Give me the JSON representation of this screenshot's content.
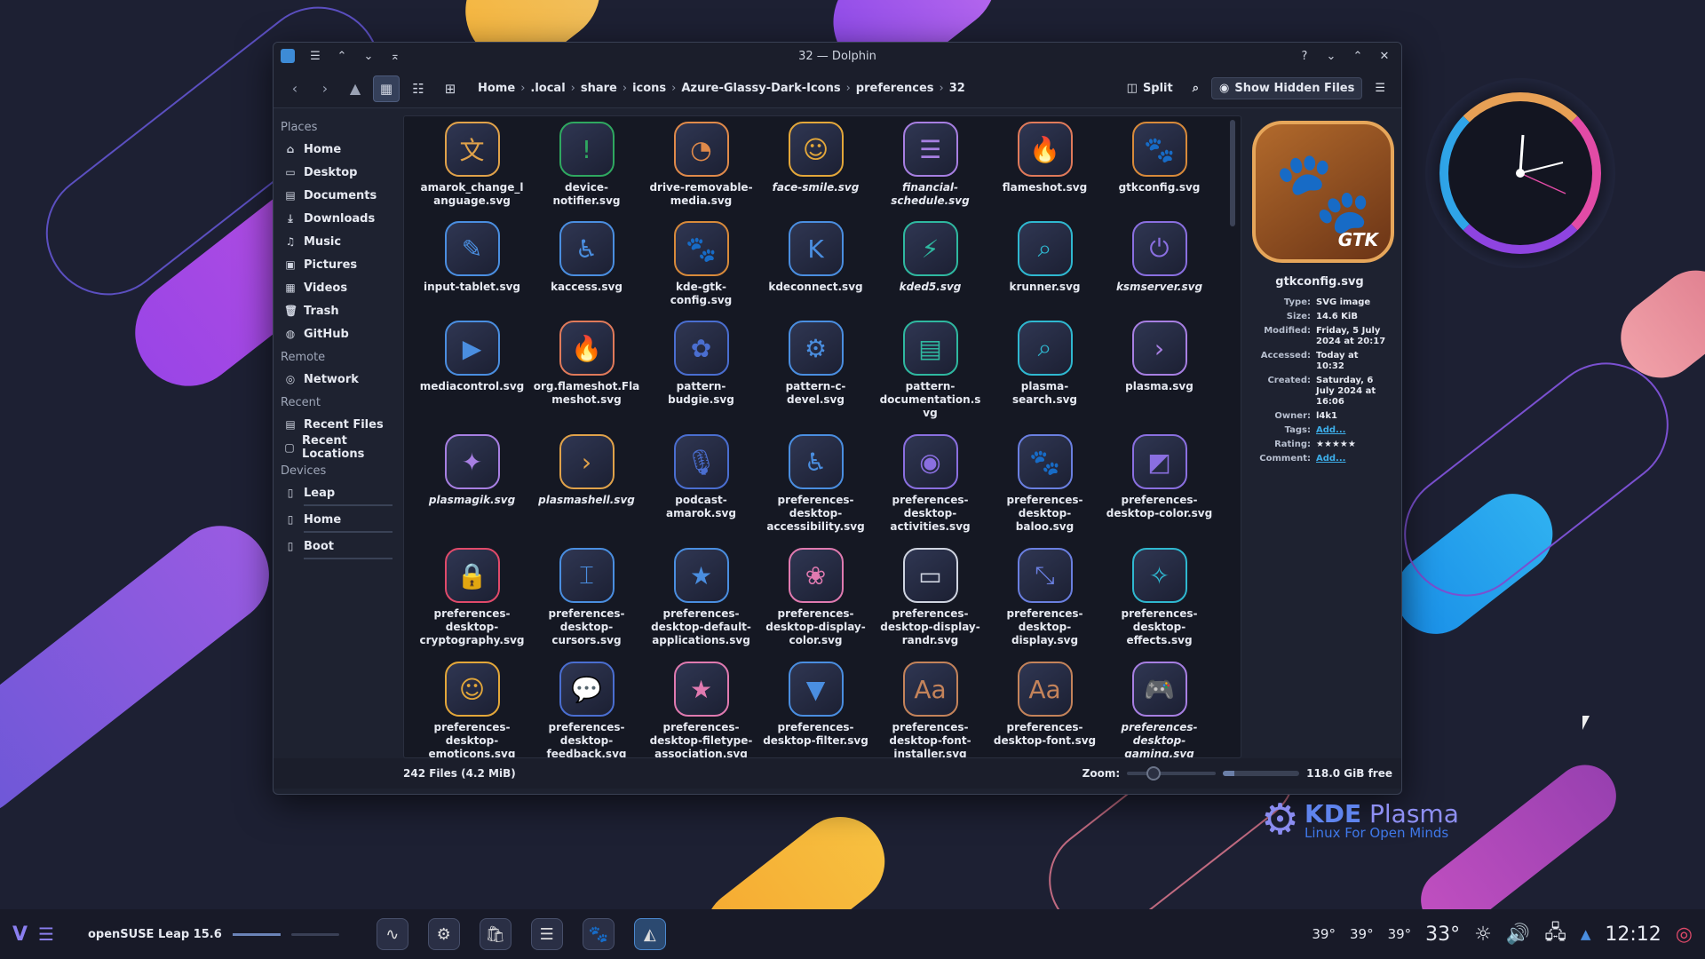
{
  "window": {
    "title": "32 — Dolphin",
    "titlebar_icons": [
      "menu-icon",
      "keep-above-icon",
      "keep-below-icon",
      "shade-icon"
    ],
    "titlebar_right": [
      "help-icon",
      "minimize-icon",
      "maximize-icon",
      "close-icon"
    ]
  },
  "toolbar": {
    "breadcrumbs": [
      "Home",
      ".local",
      "share",
      "icons",
      "Azure-Glassy-Dark-Icons",
      "preferences",
      "32"
    ],
    "split_label": "Split",
    "hidden_files_label": "Show Hidden Files"
  },
  "sidebar": {
    "places_title": "Places",
    "places": [
      {
        "label": "Home",
        "icon": "home-icon"
      },
      {
        "label": "Desktop",
        "icon": "desktop-icon"
      },
      {
        "label": "Documents",
        "icon": "documents-icon"
      },
      {
        "label": "Downloads",
        "icon": "downloads-icon"
      },
      {
        "label": "Music",
        "icon": "music-icon"
      },
      {
        "label": "Pictures",
        "icon": "pictures-icon"
      },
      {
        "label": "Videos",
        "icon": "videos-icon"
      },
      {
        "label": "Trash",
        "icon": "trash-icon"
      },
      {
        "label": "GitHub",
        "icon": "github-icon"
      }
    ],
    "remote_title": "Remote",
    "remote": [
      {
        "label": "Network",
        "icon": "network-icon"
      }
    ],
    "recent_title": "Recent",
    "recent": [
      {
        "label": "Recent Files",
        "icon": "recent-files-icon"
      },
      {
        "label": "Recent Locations",
        "icon": "recent-locations-icon"
      }
    ],
    "devices_title": "Devices",
    "devices": [
      {
        "label": "Leap",
        "icon": "drive-icon"
      },
      {
        "label": "Home",
        "icon": "drive-icon"
      },
      {
        "label": "Boot",
        "icon": "drive-icon"
      }
    ]
  },
  "files": [
    {
      "name": "amarok_change_language.svg",
      "link": false,
      "color": "#e0a24a",
      "glyph": "文"
    },
    {
      "name": "device-notifier.svg",
      "link": false,
      "color": "#2fa860",
      "glyph": "!"
    },
    {
      "name": "drive-removable-media.svg",
      "link": false,
      "color": "#e08a4a",
      "glyph": "◔"
    },
    {
      "name": "face-smile.svg",
      "link": true,
      "color": "#e3a73a",
      "glyph": "☺"
    },
    {
      "name": "financial-schedule.svg",
      "link": true,
      "color": "#a77fe2",
      "glyph": "☰"
    },
    {
      "name": "flameshot.svg",
      "link": false,
      "color": "#e07a5a",
      "glyph": "🔥"
    },
    {
      "name": "gtkconfig.svg",
      "link": false,
      "color": "#d88a3a",
      "glyph": "🐾"
    },
    {
      "name": "input-tablet.svg",
      "link": false,
      "color": "#4a8ee0",
      "glyph": "✎"
    },
    {
      "name": "kaccess.svg",
      "link": false,
      "color": "#4a8ee0",
      "glyph": "♿"
    },
    {
      "name": "kde-gtk-config.svg",
      "link": false,
      "color": "#d88a3a",
      "glyph": "🐾"
    },
    {
      "name": "kdeconnect.svg",
      "link": false,
      "color": "#4a8ee0",
      "glyph": "K"
    },
    {
      "name": "kded5.svg",
      "link": true,
      "color": "#2fb8a0",
      "glyph": "⚡"
    },
    {
      "name": "krunner.svg",
      "link": false,
      "color": "#2fb8d0",
      "glyph": "⌕"
    },
    {
      "name": "ksmserver.svg",
      "link": true,
      "color": "#8a6fe0",
      "glyph": "⏻"
    },
    {
      "name": "mediacontrol.svg",
      "link": false,
      "color": "#4a8ee0",
      "glyph": "▶"
    },
    {
      "name": "org.flameshot.Flameshot.svg",
      "link": false,
      "color": "#e07a5a",
      "glyph": "🔥"
    },
    {
      "name": "pattern-budgie.svg",
      "link": false,
      "color": "#4a6ed0",
      "glyph": "✿"
    },
    {
      "name": "pattern-c-devel.svg",
      "link": false,
      "color": "#4a8ee0",
      "glyph": "⚙"
    },
    {
      "name": "pattern-documentation.svg",
      "link": false,
      "color": "#2fb8a0",
      "glyph": "▤"
    },
    {
      "name": "plasma-search.svg",
      "link": false,
      "color": "#2fb8d0",
      "glyph": "⌕"
    },
    {
      "name": "plasma.svg",
      "link": false,
      "color": "#a77fe2",
      "glyph": "›"
    },
    {
      "name": "plasmagik.svg",
      "link": true,
      "color": "#a77fe2",
      "glyph": "✦"
    },
    {
      "name": "plasmashell.svg",
      "link": true,
      "color": "#e0a24a",
      "glyph": "›"
    },
    {
      "name": "podcast-amarok.svg",
      "link": false,
      "color": "#4a6ed0",
      "glyph": "🎙"
    },
    {
      "name": "preferences-desktop-accessibility.svg",
      "link": false,
      "color": "#4a8ee0",
      "glyph": "♿"
    },
    {
      "name": "preferences-desktop-activities.svg",
      "link": false,
      "color": "#8a6fe0",
      "glyph": "◉"
    },
    {
      "name": "preferences-desktop-baloo.svg",
      "link": false,
      "color": "#6a7fe0",
      "glyph": "🐾"
    },
    {
      "name": "preferences-desktop-color.svg",
      "link": false,
      "color": "#8a6fe0",
      "glyph": "◩"
    },
    {
      "name": "preferences-desktop-cryptography.svg",
      "link": false,
      "color": "#e04a6a",
      "glyph": "🔒"
    },
    {
      "name": "preferences-desktop-cursors.svg",
      "link": false,
      "color": "#4a8ee0",
      "glyph": "⌶"
    },
    {
      "name": "preferences-desktop-default-applications.svg",
      "link": false,
      "color": "#4a8ee0",
      "glyph": "★"
    },
    {
      "name": "preferences-desktop-display-color.svg",
      "link": false,
      "color": "#e07ab0",
      "glyph": "❀"
    },
    {
      "name": "preferences-desktop-display-randr.svg",
      "link": false,
      "color": "#cfd4e0",
      "glyph": "▭"
    },
    {
      "name": "preferences-desktop-display.svg",
      "link": false,
      "color": "#6a7fe0",
      "glyph": "⤡"
    },
    {
      "name": "preferences-desktop-effects.svg",
      "link": false,
      "color": "#2fb8d0",
      "glyph": "✧"
    },
    {
      "name": "preferences-desktop-emoticons.svg",
      "link": false,
      "color": "#e3a73a",
      "glyph": "☺"
    },
    {
      "name": "preferences-desktop-feedback.svg",
      "link": false,
      "color": "#4a6ed0",
      "glyph": "💬"
    },
    {
      "name": "preferences-desktop-filetype-association.svg",
      "link": false,
      "color": "#e07ab0",
      "glyph": "★"
    },
    {
      "name": "preferences-desktop-filter.svg",
      "link": false,
      "color": "#4a8ee0",
      "glyph": "▼"
    },
    {
      "name": "preferences-desktop-font-installer.svg",
      "link": false,
      "color": "#c4835a",
      "glyph": "Aa"
    },
    {
      "name": "preferences-desktop-font.svg",
      "link": false,
      "color": "#c4835a",
      "glyph": "Aa"
    },
    {
      "name": "preferences-desktop-gaming.svg",
      "link": true,
      "color": "#a77fe2",
      "glyph": "🎮"
    }
  ],
  "info_panel": {
    "file_name": "gtkconfig.svg",
    "icon_tag": "GTK",
    "rows": [
      {
        "key": "Type:",
        "value": "SVG image",
        "link": false
      },
      {
        "key": "Size:",
        "value": "14.6 KiB",
        "link": false
      },
      {
        "key": "Modified:",
        "value": "Friday, 5 July 2024 at 20:17",
        "link": false
      },
      {
        "key": "Accessed:",
        "value": "Today at 10:32",
        "link": false
      },
      {
        "key": "Created:",
        "value": "Saturday, 6 July 2024 at 16:06",
        "link": false
      },
      {
        "key": "Owner:",
        "value": "l4k1",
        "link": false
      },
      {
        "key": "Tags:",
        "value": "Add...",
        "link": true
      },
      {
        "key": "Rating:",
        "value": "★★★★★",
        "link": false
      },
      {
        "key": "Comment:",
        "value": "Add...",
        "link": true
      }
    ]
  },
  "status": {
    "files_summary": "242 Files (4.2 MiB)",
    "zoom_label": "Zoom:",
    "free_space": "118.0 GiB free",
    "zoom_level": 0.22,
    "used_space_fraction": 0.15
  },
  "kde": {
    "title_bold": "KDE",
    "title_light": " Plasma",
    "subtitle": "Linux For Open Minds"
  },
  "taskbar": {
    "distro_label": "openSUSE Leap 15.6",
    "temps": [
      "39°",
      "39°",
      "39°"
    ],
    "weather_temp": "33°",
    "time": "12:12",
    "apps": [
      {
        "icon": "system-monitor-icon",
        "active": false
      },
      {
        "icon": "settings-icon",
        "active": false
      },
      {
        "icon": "shop-icon",
        "active": false
      },
      {
        "icon": "mixer-icon",
        "active": false
      },
      {
        "icon": "gtkconfig-icon",
        "active": false
      },
      {
        "icon": "dolphin-icon",
        "active": true
      }
    ]
  }
}
